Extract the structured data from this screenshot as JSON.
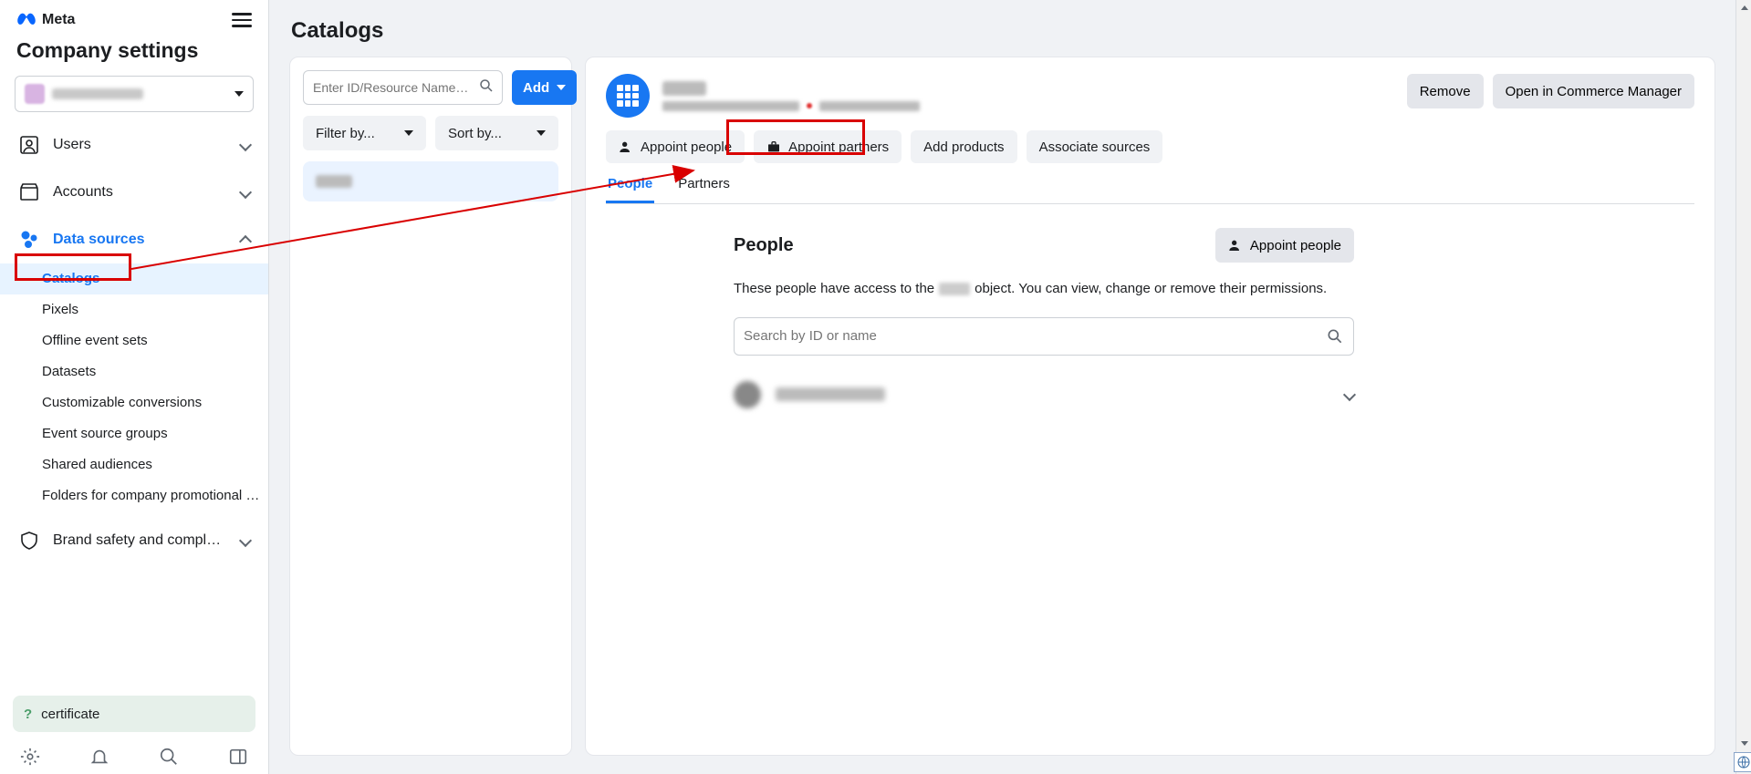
{
  "brand": "Meta",
  "page_title": "Company settings",
  "sidebar": {
    "users": "Users",
    "accounts": "Accounts",
    "data_sources": "Data sources",
    "brand_safety": "Brand safety and compl…",
    "ds_children": {
      "catalogs": "Catalogs",
      "pixels": "Pixels",
      "offline": "Offline event sets",
      "datasets": "Datasets",
      "custom": "Customizable conversions",
      "esg": "Event source groups",
      "shared": "Shared audiences",
      "folders": "Folders for company promotional …"
    },
    "certificate": "certificate"
  },
  "main_heading": "Catalogs",
  "left_col": {
    "search_placeholder": "Enter ID/Resource Name…",
    "add": "Add",
    "filter": "Filter by...",
    "sort": "Sort by..."
  },
  "detail": {
    "remove": "Remove",
    "open_commerce": "Open in Commerce Manager",
    "appoint_people": "Appoint people",
    "appoint_partners": "Appoint partners",
    "add_products": "Add products",
    "associate_sources": "Associate sources",
    "tab_people": "People",
    "tab_partners": "Partners",
    "people_heading": "People",
    "appoint_people_btn": "Appoint people",
    "desc_a": "These people have access to the",
    "desc_b": "object. You can view, change or remove their permissions.",
    "people_search_placeholder": "Search by ID or name"
  }
}
